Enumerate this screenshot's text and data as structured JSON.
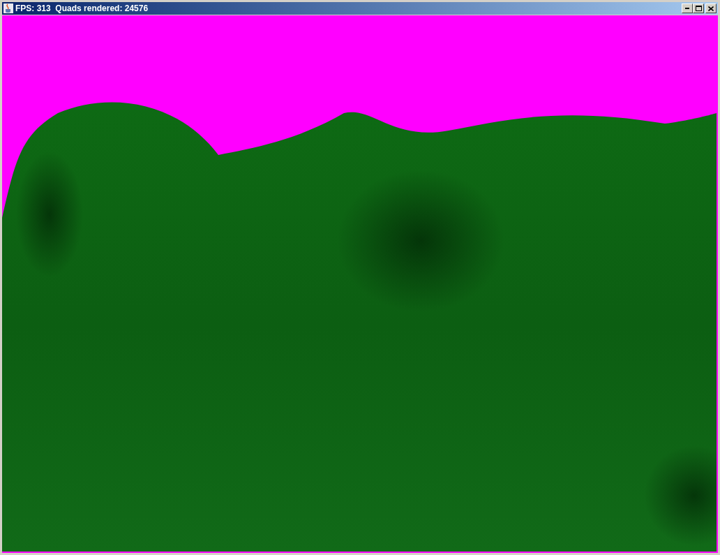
{
  "window": {
    "title": "FPS: 313  Quads rendered: 24576"
  }
}
